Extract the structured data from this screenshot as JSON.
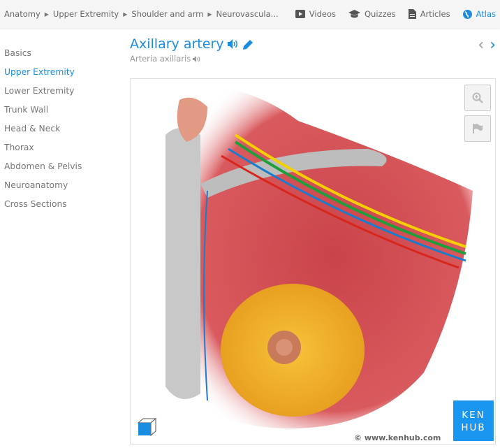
{
  "breadcrumb": [
    "Anatomy",
    "Upper Extremity",
    "Shoulder and arm",
    "Neurovascula..."
  ],
  "nav": [
    {
      "label": "Videos",
      "icon": "play-icon"
    },
    {
      "label": "Quizzes",
      "icon": "graduation-cap-icon"
    },
    {
      "label": "Articles",
      "icon": "document-icon"
    },
    {
      "label": "Atlas",
      "icon": "globe-icon",
      "active": true
    }
  ],
  "sidebar": {
    "items": [
      {
        "label": "Basics"
      },
      {
        "label": "Upper Extremity",
        "active": true
      },
      {
        "label": "Lower Extremity"
      },
      {
        "label": "Trunk Wall"
      },
      {
        "label": "Head & Neck"
      },
      {
        "label": "Thorax"
      },
      {
        "label": "Abdomen & Pelvis"
      },
      {
        "label": "Neuroanatomy"
      },
      {
        "label": "Cross Sections"
      }
    ]
  },
  "header": {
    "title": "Axillary artery",
    "latin": "Arteria axillaris"
  },
  "image": {
    "logo": "KEN HUB",
    "copyright": "© www.kenhub.com"
  },
  "colors": {
    "accent": "#1a8de0",
    "logo": "#1a95f0"
  }
}
